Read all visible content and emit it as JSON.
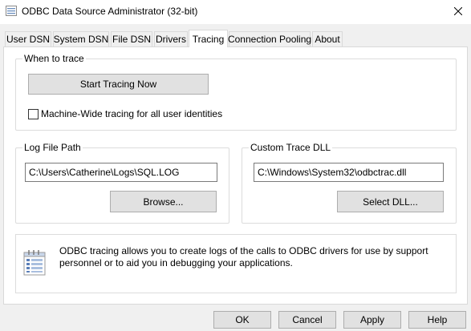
{
  "window": {
    "title": "ODBC Data Source Administrator (32-bit)"
  },
  "tabs": [
    {
      "label": "User DSN",
      "active": false
    },
    {
      "label": "System DSN",
      "active": false
    },
    {
      "label": "File DSN",
      "active": false
    },
    {
      "label": "Drivers",
      "active": false
    },
    {
      "label": "Tracing",
      "active": true
    },
    {
      "label": "Connection Pooling",
      "active": false
    },
    {
      "label": "About",
      "active": false
    }
  ],
  "when_to_trace": {
    "group_label": "When to trace",
    "start_button_label": "Start Tracing Now",
    "machine_wide_label": "Machine-Wide tracing for all user identities",
    "machine_wide_checked": false
  },
  "log_file": {
    "group_label": "Log File Path",
    "path_value": "C:\\Users\\Catherine\\Logs\\SQL.LOG",
    "browse_label": "Browse..."
  },
  "trace_dll": {
    "group_label": "Custom Trace DLL",
    "path_value": "C:\\Windows\\System32\\odbctrac.dll",
    "select_label": "Select DLL..."
  },
  "info": {
    "icon": "odbc-info-icon",
    "text": "ODBC tracing allows you to create logs of the calls to ODBC drivers for use by support personnel or to aid you in debugging your applications."
  },
  "footer": {
    "ok_label": "OK",
    "cancel_label": "Cancel",
    "apply_label": "Apply",
    "help_label": "Help"
  },
  "colors": {
    "window_bg": "#f0f0f0",
    "panel_bg": "#ffffff",
    "button_bg": "#e1e1e1",
    "button_border": "#adadad"
  }
}
